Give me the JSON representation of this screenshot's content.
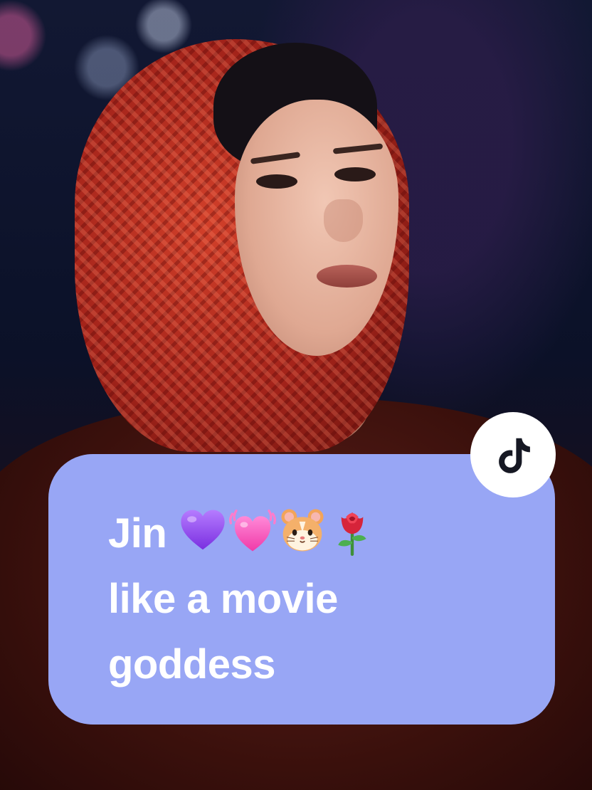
{
  "caption": {
    "line1_text": "Jin",
    "line2_text": "like a movie",
    "line3_text": "goddess",
    "emojis": [
      "purple-heart-icon",
      "beating-heart-icon",
      "hamster-icon",
      "rose-icon"
    ]
  },
  "colors": {
    "caption_card": "#98a6f5",
    "caption_text": "#ffffff",
    "logo_badge": "#ffffff",
    "logo": "#161823"
  },
  "logo": {
    "icon": "tiktok-logo-icon"
  }
}
